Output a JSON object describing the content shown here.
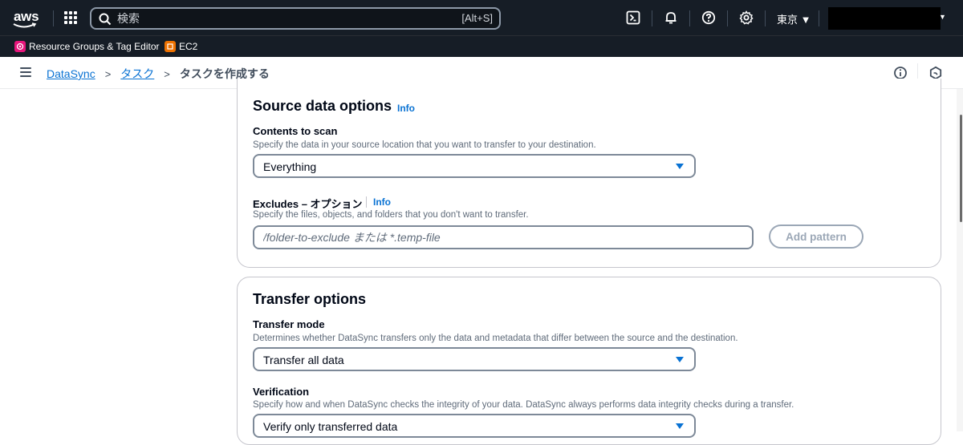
{
  "topnav": {
    "logo_text": "aws",
    "search_placeholder": "検索",
    "search_shortcut": "[Alt+S]",
    "region": "東京 ▼",
    "icons": [
      "cloudshell-icon",
      "bell-icon",
      "help-icon",
      "gear-icon"
    ]
  },
  "favorites": [
    {
      "label": "Resource Groups & Tag Editor",
      "icon": "resource-groups-icon",
      "color": "#e7157b"
    },
    {
      "label": "EC2",
      "icon": "ec2-icon",
      "color": "#ed7100"
    }
  ],
  "breadcrumb": {
    "items": [
      "DataSync",
      "タスク"
    ],
    "current": "タスクを作成する",
    "separator": ">"
  },
  "source_options": {
    "title": "Source data options",
    "info": "Info",
    "contents_label": "Contents to scan",
    "contents_desc": "Specify the data in your source location that you want to transfer to your destination.",
    "contents_value": "Everything",
    "excludes_label": "Excludes – オプション",
    "excludes_info": "Info",
    "excludes_desc": "Specify the files, objects, and folders that you don't want to transfer.",
    "excludes_placeholder": "/folder-to-exclude または *.temp-file",
    "add_pattern": "Add pattern"
  },
  "transfer_options": {
    "title": "Transfer options",
    "mode_label": "Transfer mode",
    "mode_desc": "Determines whether DataSync transfers only the data and metadata that differ between the source and the destination.",
    "mode_value": "Transfer all data",
    "verification_label": "Verification",
    "verification_desc": "Specify how and when DataSync checks the integrity of your data. DataSync always performs data integrity checks during a transfer.",
    "verification_value": "Verify only transferred data"
  },
  "colors": {
    "nav_bg": "#161d26",
    "link": "#0972d3",
    "border": "#c6c6cd"
  }
}
